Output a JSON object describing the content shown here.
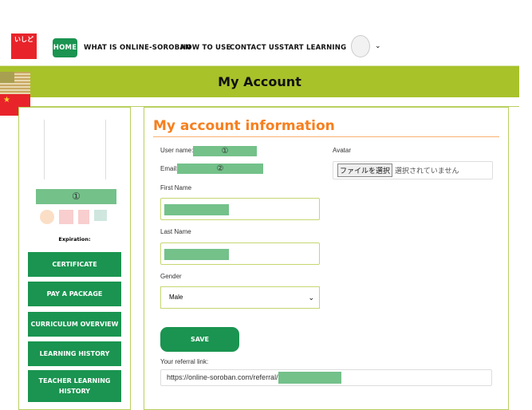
{
  "header": {
    "logo_text": "いしど",
    "nav": [
      "HOME",
      "WHAT IS ONLINE-SOROBAN",
      "HOW TO USE",
      "CONTACT US",
      "START LEARNING"
    ],
    "avatar_chevron": "⌄"
  },
  "banner": {
    "title": "My Account"
  },
  "languages": [
    "en-flag",
    "zh-flag"
  ],
  "sidebar": {
    "username_redacted": "①",
    "expiration_label": "Expiration:",
    "buttons": [
      "CERTIFICATE",
      "PAY A PACKAGE",
      "CURRICULUM OVERVIEW",
      "LEARNING HISTORY",
      "TEACHER LEARNING HISTORY"
    ]
  },
  "form": {
    "title": "My account information",
    "username_label": "User name:",
    "username_value": "①",
    "email_label": "Email:",
    "email_value": "②",
    "first_name_label": "First Name",
    "last_name_label": "Last Name",
    "gender_label": "Gender",
    "gender_value": "Male",
    "avatar_label": "Avatar",
    "file_button": "ファイルを選択",
    "file_status": "選択されていません",
    "save_label": "SAVE",
    "referral_label": "Your referral link:",
    "referral_value": "https://online-soroban.com/referral/"
  },
  "colors": {
    "brand_green": "#1a9450",
    "banner": "#a8c22a",
    "accent_orange": "#f77f1e",
    "redaction": "#74c18a"
  }
}
